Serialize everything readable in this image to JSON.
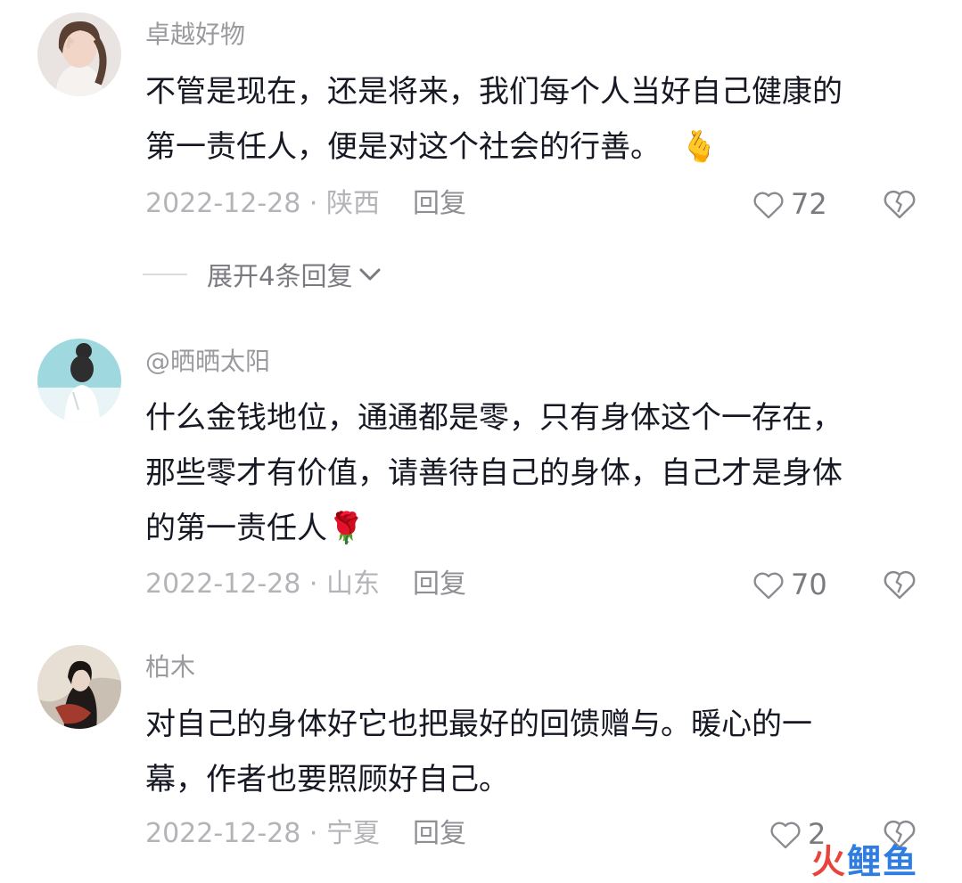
{
  "comments": [
    {
      "username": "卓越好物",
      "lines": [
        "不管是现在，还是将来，我们每个人当好自己健康的",
        "第一责任人，便是对这个社会的行善。"
      ],
      "emoji": "🫰",
      "date_region": "2022-12-28 · 陕西",
      "reply_label": "回复",
      "likes": "72"
    },
    {
      "username": "@晒晒太阳",
      "lines": [
        "什么金钱地位，通通都是零，只有身体这个一存在，",
        "那些零才有价值，请善待自己的身体，自己才是身体",
        "的第一责任人"
      ],
      "emoji": "🌹",
      "date_region": "2022-12-28 · 山东",
      "reply_label": "回复",
      "likes": "70"
    },
    {
      "username": "柏木",
      "lines": [
        "对自己的身体好它也把最好的回馈赠与。暖心的一",
        "幕，作者也要照顾好自己。"
      ],
      "date_region": "2022-12-28 · 宁夏",
      "reply_label": "回复",
      "likes": "2"
    }
  ],
  "expand_replies": "展开4条回复",
  "watermark": {
    "char1": "火",
    "rest": "鲤鱼"
  },
  "colors": {
    "heart_outline": "#8a8a90",
    "watermark_red": "#e8433c",
    "watermark_blue": "#2f7de1"
  }
}
